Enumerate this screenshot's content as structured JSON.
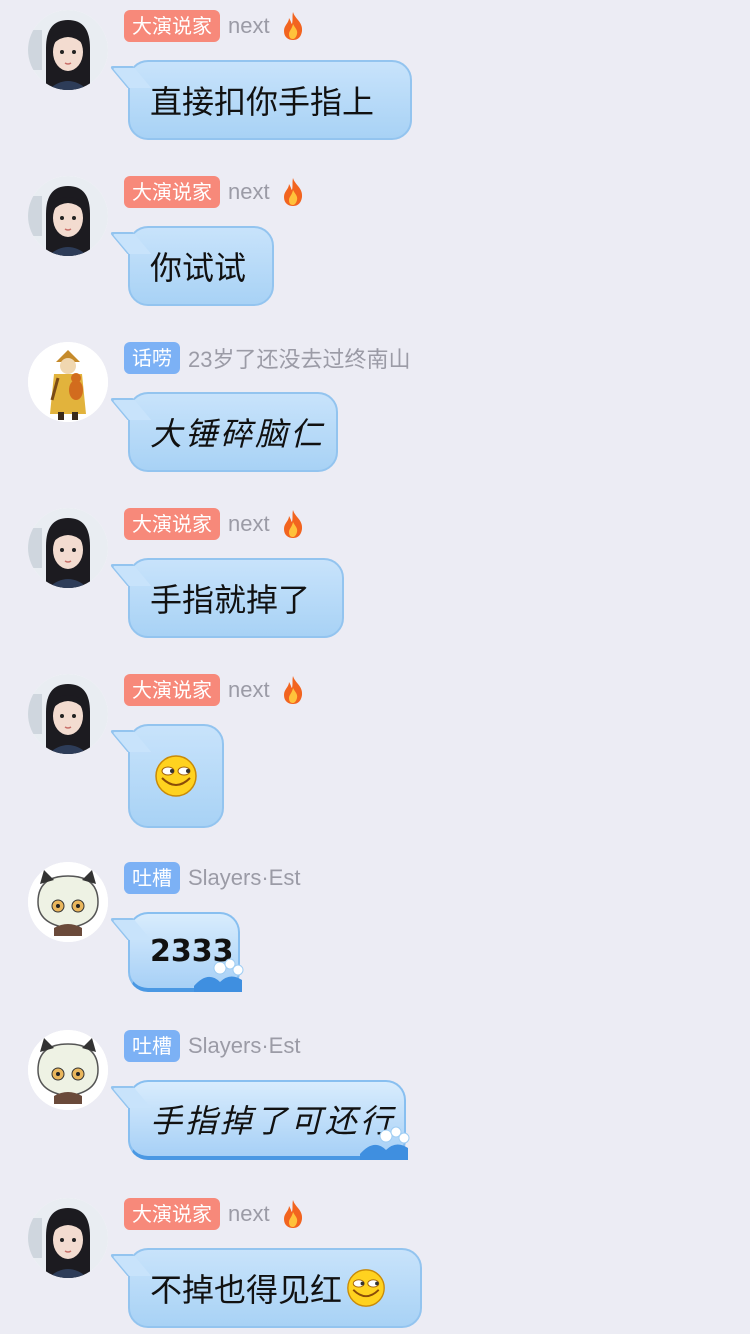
{
  "messages": [
    {
      "badge": "大演说家",
      "badge_color": "red",
      "nick": "next",
      "flame": true,
      "text": "直接扣你手指上",
      "avatar": "girl-avatar"
    },
    {
      "badge": "大演说家",
      "badge_color": "red",
      "nick": "next",
      "flame": true,
      "text": "你试试",
      "avatar": "girl-avatar"
    },
    {
      "badge": "话唠",
      "badge_color": "blue",
      "nick": "23岁了还没去过终南山",
      "flame": false,
      "text": "大锤碎脑仁",
      "avatar": "monk-avatar"
    },
    {
      "badge": "大演说家",
      "badge_color": "red",
      "nick": "next",
      "flame": true,
      "text": "手指就掉了",
      "avatar": "girl-avatar"
    },
    {
      "badge": "大演说家",
      "badge_color": "red",
      "nick": "next",
      "flame": true,
      "text": "",
      "emoji": "smirk-emoji",
      "avatar": "girl-avatar"
    },
    {
      "badge": "吐槽",
      "badge_color": "blue",
      "nick": "Slayers·Est",
      "flame": false,
      "text": "2333",
      "avatar": "cat-girl-avatar"
    },
    {
      "badge": "吐槽",
      "badge_color": "blue",
      "nick": "Slayers·Est",
      "flame": false,
      "text": "手指掉了可还行",
      "avatar": "cat-girl-avatar"
    },
    {
      "badge": "大演说家",
      "badge_color": "red",
      "nick": "next",
      "flame": true,
      "text": "不掉也得见红",
      "emoji": "smirk-emoji",
      "avatar": "girl-avatar"
    }
  ],
  "colors": {
    "background": "#ececf4",
    "badge_red": "#f7897a",
    "badge_blue": "#7cb1f5",
    "bubble": "#b8dbf8",
    "nick": "#9b9ba6"
  }
}
